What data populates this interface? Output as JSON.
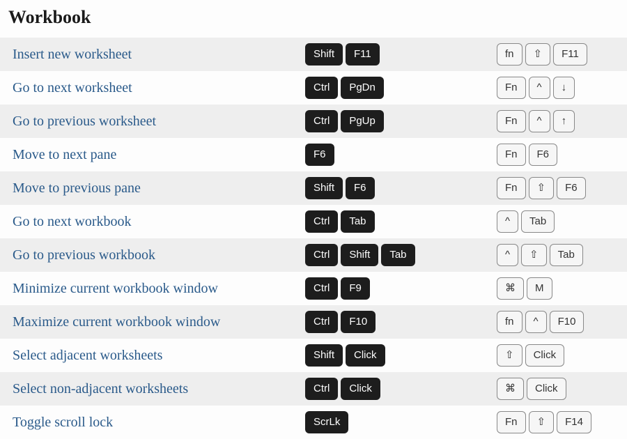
{
  "heading": "Workbook",
  "rows": [
    {
      "label": "Insert new worksheet",
      "win": [
        "Shift",
        "F11"
      ],
      "mac": [
        "fn",
        "⇧",
        "F11"
      ]
    },
    {
      "label": "Go to next worksheet",
      "win": [
        "Ctrl",
        "PgDn"
      ],
      "mac": [
        "Fn",
        "^",
        "↓"
      ]
    },
    {
      "label": "Go to previous worksheet",
      "win": [
        "Ctrl",
        "PgUp"
      ],
      "mac": [
        "Fn",
        "^",
        "↑"
      ]
    },
    {
      "label": "Move to next pane",
      "win": [
        "F6"
      ],
      "mac": [
        "Fn",
        "F6"
      ]
    },
    {
      "label": "Move to previous pane",
      "win": [
        "Shift",
        "F6"
      ],
      "mac": [
        "Fn",
        "⇧",
        "F6"
      ]
    },
    {
      "label": "Go to next workbook",
      "win": [
        "Ctrl",
        "Tab"
      ],
      "mac": [
        "^",
        "Tab"
      ]
    },
    {
      "label": "Go to previous workbook",
      "win": [
        "Ctrl",
        "Shift",
        "Tab"
      ],
      "mac": [
        "^",
        "⇧",
        "Tab"
      ]
    },
    {
      "label": "Minimize current workbook window",
      "win": [
        "Ctrl",
        "F9"
      ],
      "mac": [
        "⌘",
        "M"
      ]
    },
    {
      "label": "Maximize current workbook window",
      "win": [
        "Ctrl",
        "F10"
      ],
      "mac": [
        "fn",
        "^",
        "F10"
      ]
    },
    {
      "label": "Select adjacent worksheets",
      "win": [
        "Shift",
        "Click"
      ],
      "mac": [
        "⇧",
        "Click"
      ]
    },
    {
      "label": "Select non-adjacent worksheets",
      "win": [
        "Ctrl",
        "Click"
      ],
      "mac": [
        "⌘",
        "Click"
      ]
    },
    {
      "label": "Toggle scroll lock",
      "win": [
        "ScrLk"
      ],
      "mac": [
        "Fn",
        "⇧",
        "F14"
      ]
    }
  ]
}
